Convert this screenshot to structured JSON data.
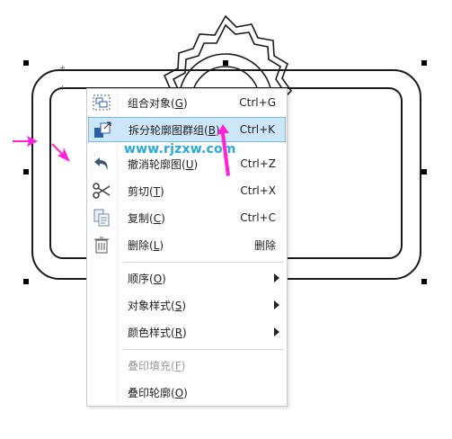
{
  "menu": {
    "items": [
      {
        "label": "组合对象(G)",
        "mnemonic": "G",
        "shortcut": "Ctrl+G",
        "icon": "group-objects-icon"
      },
      {
        "label": "拆分轮廓图群组(B)",
        "mnemonic": "B",
        "shortcut": "Ctrl+K",
        "icon": "break-apart-icon",
        "highlighted": true
      },
      {
        "label": "撤消轮廓图(U)",
        "mnemonic": "U",
        "shortcut": "Ctrl+Z",
        "icon": "undo-icon"
      },
      {
        "label": "剪切(T)",
        "mnemonic": "T",
        "shortcut": "Ctrl+X",
        "icon": "scissors-icon"
      },
      {
        "label": "复制(C)",
        "mnemonic": "C",
        "shortcut": "Ctrl+C",
        "icon": "copy-icon"
      },
      {
        "label": "删除(L)",
        "mnemonic": "L",
        "shortcut": "删除",
        "icon": "trash-icon"
      },
      {
        "label": "顺序(O)",
        "mnemonic": "O",
        "submenu": true
      },
      {
        "label": "对象样式(S)",
        "mnemonic": "S",
        "submenu": true
      },
      {
        "label": "颜色样式(R)",
        "mnemonic": "R",
        "submenu": true
      },
      {
        "label": "叠印填充(F)",
        "mnemonic": "F",
        "disabled": true
      },
      {
        "label": "叠印轮廓(O)",
        "mnemonic": "O"
      }
    ]
  },
  "watermark": {
    "text": "www.rjzxw.com"
  },
  "colors": {
    "highlight_bg": "#cce6fa",
    "highlight_border": "#7bb7e3",
    "arrow_magenta": "#ff22dd",
    "watermark_blue": "#2aa7de",
    "disabled_text": "#9a9a9a"
  }
}
